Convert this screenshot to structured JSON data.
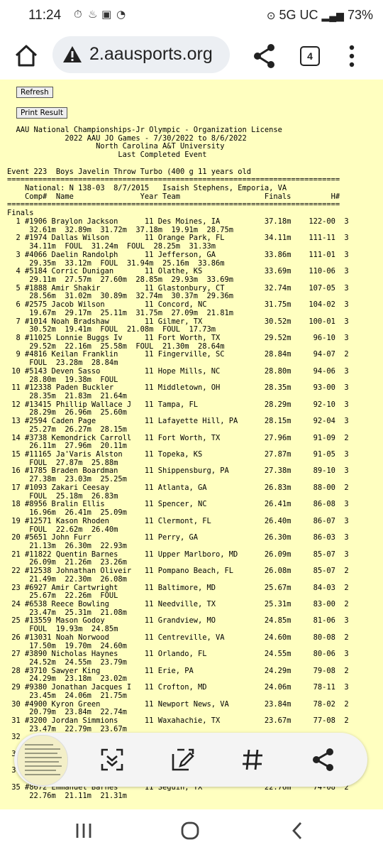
{
  "status_bar": {
    "time": "11:24",
    "network": "5G UC",
    "battery": "73%"
  },
  "browser": {
    "url": "2.aausports.org",
    "tab_count": "4"
  },
  "page": {
    "refresh_label": "Refresh",
    "print_label": "Print Result",
    "results_text": "  AAU National Championships-Jr Olympic - Organization License\n             2022 AAU JO Games - 7/30/2022 to 8/6/2022\n                    North Carolina A&T University\n                         Last Completed Event\n\nEvent 223  Boys Javelin Throw Turbo (400 g 11 years old\n===========================================================================\n    National: N 138-03  8/7/2015   Isaish Stephens, Emporia, VA\n    Comp#  Name               Year Team                   Finals         H#\n===========================================================================\nFinals\n  1 #1906 Braylon Jackson      11 Des Moines, IA          37.18m    122-00  3\n     32.61m  32.89m  31.72m  37.18m  19.91m  28.75m\n  2 #1974 Dallas Wilson        11 Orange Park, FL         34.11m    111-11  3\n     34.11m  FOUL  31.24m  FOUL  28.25m  31.33m\n  3 #4066 Daelin Randolph      11 Jefferson, GA           33.86m    111-01  3\n     29.35m  33.12m  FOUL  31.94m  25.16m  33.86m\n  4 #5184 Corric Dunigan       11 Olathe, KS              33.69m    110-06  3\n     29.11m  27.57m  27.60m  28.85m  29.93m  33.69m\n  5 #1888 Amir Shakir          11 Glastonbury, CT         32.74m    107-05  3\n     28.56m  31.02m  30.89m  32.74m  30.37m  29.36m\n  6 #2575 Jacob Wilson         11 Concord, NC             31.75m    104-02  3\n     19.67m  29.17m  25.11m  31.75m  27.09m  21.81m\n  7 #1014 Noah Bradshaw        11 Gilmer, TX              30.52m    100-01  3\n     30.52m  19.41m  FOUL  21.08m  FOUL  17.73m\n  8 #11025 Lonnie Buggs Iv     11 Fort Worth, TX          29.52m     96-10  3\n     29.52m  22.16m  25.58m  FOUL  21.30m  28.64m\n  9 #4816 Keilan Franklin      11 Fingerville, SC         28.84m     94-07  2\n     FOUL  23.28m  28.84m\n 10 #5143 Deven Sasso          11 Hope Mills, NC          28.80m     94-06  3\n     28.80m  19.38m  FOUL\n 11 #12338 Paden Buckler       11 Middletown, OH          28.35m     93-00  3\n     28.35m  21.83m  21.64m\n 12 #13415 Phillip Wallace J   11 Tampa, FL               28.29m     92-10  3\n     28.29m  26.96m  25.60m\n 13 #2594 Caden Page           11 Lafayette Hill, PA      28.15m     92-04  3\n     25.27m  26.27m  28.15m\n 14 #3738 Kemondrick Carroll   11 Fort Worth, TX          27.96m     91-09  2\n     26.11m  27.96m  20.11m\n 15 #11165 Ja'Varis Alston     11 Topeka, KS              27.87m     91-05  3\n     FOUL  27.87m  25.88m\n 16 #1785 Braden Boardman      11 Shippensburg, PA        27.38m     89-10  3\n     27.38m  23.03m  25.25m\n 17 #1093 Zakari Ceesay        11 Atlanta, GA             26.83m     88-00  2\n     FOUL  25.18m  26.83m\n 18 #8956 Bralin Ellis         11 Spencer, NC             26.41m     86-08  3\n     16.96m  26.41m  25.09m\n 19 #12571 Kason Rhoden        11 Clermont, FL            26.40m     86-07  3\n     FOUL  22.62m  26.40m\n 20 #5651 John Furr            11 Perry, GA               26.30m     86-03  3\n     21.13m  26.30m  22.93m\n 21 #11822 Quentin Barnes      11 Upper Marlboro, MD      26.09m     85-07  3\n     26.09m  21.26m  23.26m\n 22 #12538 Johnathan Oliveir   11 Pompano Beach, FL       26.08m     85-07  2\n     21.49m  22.30m  26.08m\n 23 #6927 Amir Cartwright      11 Baltimore, MD           25.67m     84-03  2\n     25.67m  22.26m  FOUL\n 24 #6538 Reece Bowling        11 Needville, TX           25.31m     83-00  2\n     23.47m  25.31m  21.08m\n 25 #13559 Mason Godoy         11 Grandview, MO           24.85m     81-06  3\n     FOUL  19.93m  24.85m\n 26 #13031 Noah Norwood        11 Centreville, VA         24.60m     80-08  2\n     17.50m  19.70m  24.60m\n 27 #3890 Nicholas Haynes      11 Orlando, FL             24.55m     80-06  3\n     24.52m  24.55m  23.79m\n 28 #3710 Sawyer King          11 Erie, PA                24.29m     79-08  2\n     24.29m  23.18m  23.02m\n 29 #9380 Jonathan Jacques I   11 Crofton, MD             24.06m     78-11  3\n     23.45m  24.06m  21.75m\n 30 #4900 Kyron Green          11 Newport News, VA        23.84m     78-02  2\n     20.79m  23.84m  22.74m\n 31 #3200 Jordan Simmions      11 Waxahachie, TX          23.67m     77-08  2\n     23.47m  22.79m  23.67m\n 32\n\n 3\n\n 3\n\n 35 #8672 Emmanuel Barnes      11 Seguin, TX              22.76m     74-08  2\n     22.76m  21.11m  21.31m"
  },
  "colors": {
    "page_bg": "#ffffc0",
    "urlbar_bg": "#eceff3",
    "action_bar_bg": "#f4f4f4"
  },
  "icons": {
    "home": "home-icon",
    "warning": "warning-icon",
    "share": "share-icon",
    "tabs": "tabs-icon",
    "menu": "more-vert-icon",
    "scroll_capture": "scroll-capture-icon",
    "draw": "draw-icon",
    "tag": "hashtag-icon",
    "back": "back-icon",
    "recents": "recents-icon",
    "nav_home": "nav-home-icon"
  }
}
